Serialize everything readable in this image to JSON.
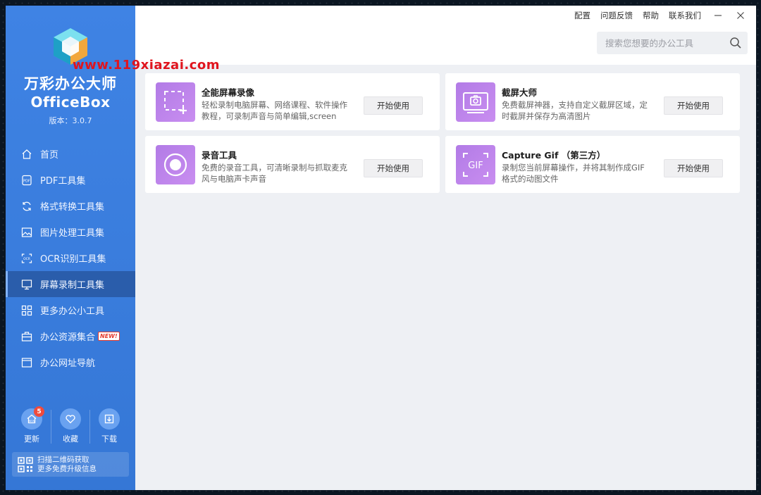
{
  "watermark": "www.119xiazai.com",
  "app": {
    "title_cn": "万彩办公大师",
    "title_en": "OfficeBox",
    "version": "版本：3.0.7"
  },
  "sidebar": {
    "items": [
      {
        "label": "首页",
        "icon": "home-icon"
      },
      {
        "label": "PDF工具集",
        "icon": "pdf-icon"
      },
      {
        "label": "格式转换工具集",
        "icon": "convert-icon"
      },
      {
        "label": "图片处理工具集",
        "icon": "image-icon"
      },
      {
        "label": "OCR识别工具集",
        "icon": "ocr-icon"
      },
      {
        "label": "屏幕录制工具集",
        "icon": "monitor-icon",
        "active": true
      },
      {
        "label": "更多办公小工具",
        "icon": "grid-icon"
      },
      {
        "label": "办公资源集合",
        "icon": "briefcase-icon",
        "badge": "NEW!"
      },
      {
        "label": "办公网址导航",
        "icon": "browser-icon"
      }
    ],
    "actions": [
      {
        "label": "更新",
        "icon": "update-icon",
        "count": "5"
      },
      {
        "label": "收藏",
        "icon": "heart-icon"
      },
      {
        "label": "下载",
        "icon": "download-icon"
      }
    ],
    "qr": {
      "line1": "扫描二维码获取",
      "line2": "更多免费升级信息"
    }
  },
  "topbar": {
    "links": [
      "配置",
      "问题反馈",
      "帮助",
      "联系我们"
    ]
  },
  "search": {
    "placeholder": "搜索您想要的办公工具"
  },
  "cards": [
    {
      "title": "全能屏幕录像",
      "desc": "轻松录制电脑屏幕、网络课程、软件操作教程，可录制声音与简单编辑,screen",
      "button": "开始使用",
      "icon": "screen-record-icon"
    },
    {
      "title": "截屏大师",
      "desc": "免费截屏神器，支持自定义截屏区域，定时截屏并保存为高清图片",
      "button": "开始使用",
      "icon": "screenshot-icon"
    },
    {
      "title": "录音工具",
      "desc": "免费的录音工具，可清晰录制与抓取麦克风与电脑声卡声音",
      "button": "开始使用",
      "icon": "audio-record-icon"
    },
    {
      "title": "Capture Gif （第三方）",
      "desc": "录制您当前屏幕操作，并将其制作成GIF格式的动图文件",
      "button": "开始使用",
      "icon": "gif-icon"
    }
  ]
}
